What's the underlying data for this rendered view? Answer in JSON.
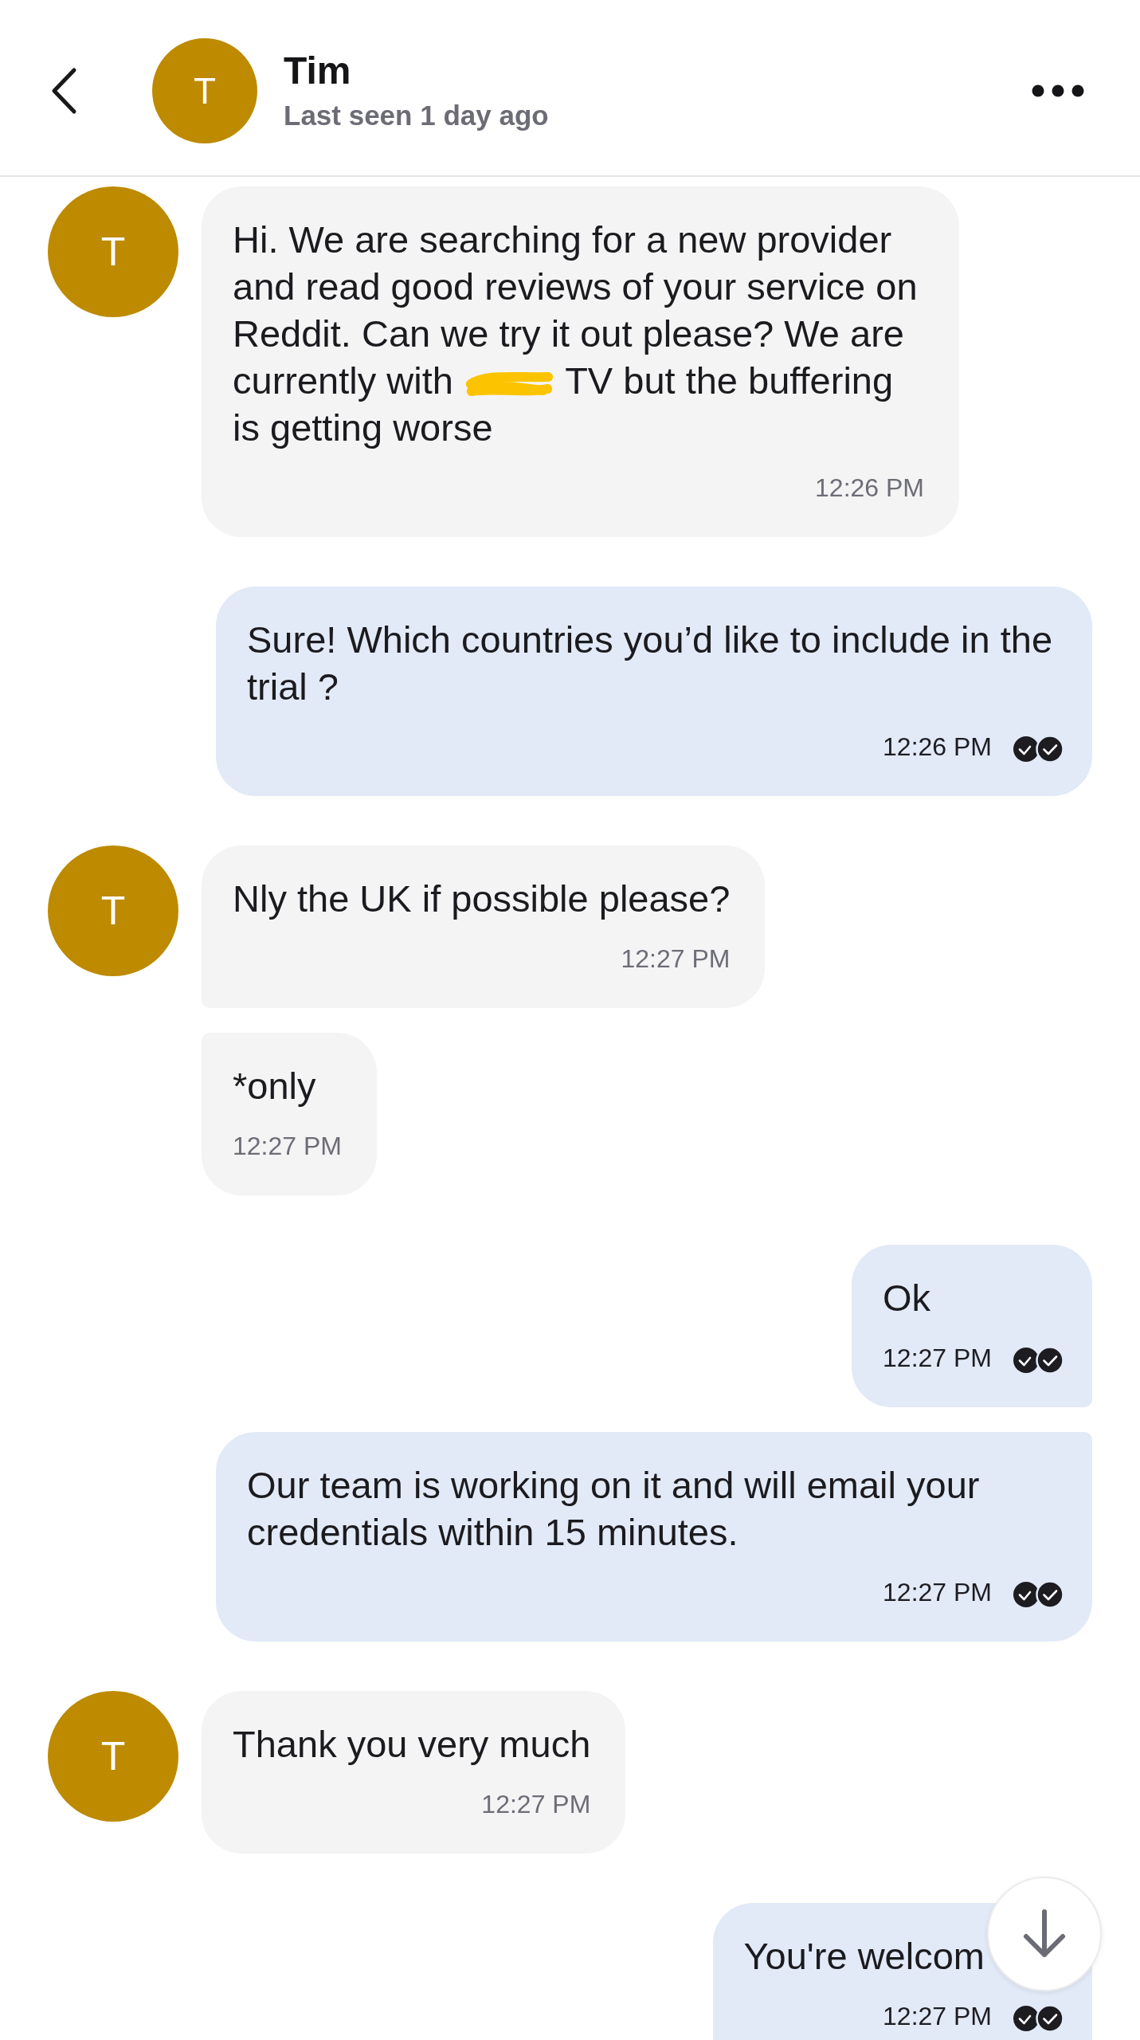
{
  "header": {
    "avatar_letter": "T",
    "name": "Tim",
    "last_seen": "Last seen 1 day ago"
  },
  "messages": [
    {
      "kind": "incoming",
      "avatar_letter": "T",
      "text": "Hi. We are searching for a new provider and read good reviews of your service on Reddit. Can we try it out please? We are currently with",
      "redacted": true,
      "text_after": "TV but the buffering is getting worse",
      "time": "12:26 PM"
    },
    {
      "kind": "outgoing",
      "text": "Sure! Which countries you’d like to include in the trial ?",
      "time": "12:26 PM",
      "read": true
    },
    {
      "kind": "incoming",
      "avatar_letter": "T",
      "text": "Nly the UK if possible please?",
      "time": "12:27 PM"
    },
    {
      "kind": "incoming",
      "text": "*only",
      "time": "12:27 PM"
    },
    {
      "kind": "outgoing",
      "text": "Ok",
      "time": "12:27 PM",
      "read": true
    },
    {
      "kind": "outgoing",
      "text": "Our team is working on it and will email your credentials within 15 minutes.",
      "time": "12:27 PM",
      "read": true
    },
    {
      "kind": "incoming",
      "avatar_letter": "T",
      "text": "Thank you very much",
      "time": "12:27 PM"
    },
    {
      "kind": "outgoing",
      "text": "You're welcom",
      "time": "12:27 PM",
      "read": true
    }
  ]
}
